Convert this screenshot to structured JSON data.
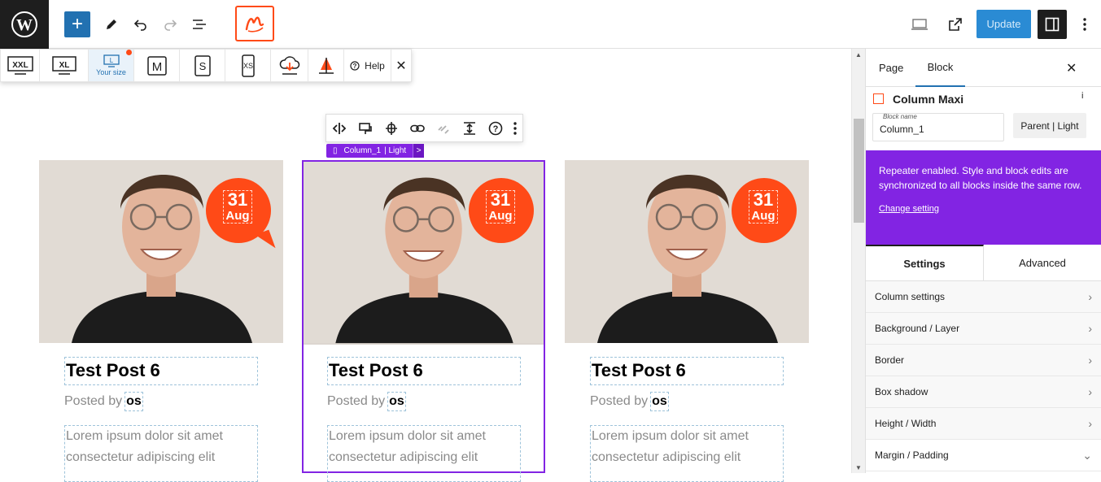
{
  "topbar": {
    "update_label": "Update"
  },
  "responsive": {
    "items": [
      {
        "label": "XXL"
      },
      {
        "label": "XL"
      },
      {
        "label": "L",
        "caption": "Your size"
      },
      {
        "label": "M"
      },
      {
        "label": "S"
      },
      {
        "label": "XS"
      }
    ],
    "help_label": "Help"
  },
  "block_toolbar": {
    "breadcrumb": "Column_1",
    "breadcrumb_style": "| Light",
    "breadcrumb_more": ">"
  },
  "posts": [
    {
      "day": "31",
      "month": "Aug",
      "title": "Test Post 6",
      "posted_by": "Posted by",
      "author": "os",
      "excerpt": "Lorem ipsum dolor sit amet consectetur adipiscing elit"
    },
    {
      "day": "31",
      "month": "Aug",
      "title": "Test Post 6",
      "posted_by": "Posted by",
      "author": "os",
      "excerpt": "Lorem ipsum dolor sit amet consectetur adipiscing elit"
    },
    {
      "day": "31",
      "month": "Aug",
      "title": "Test Post 6",
      "posted_by": "Posted by",
      "author": "os",
      "excerpt": "Lorem ipsum dolor sit amet consectetur adipiscing elit"
    }
  ],
  "panel": {
    "tab_page": "Page",
    "tab_block": "Block",
    "block_title": "Column Maxi",
    "info": "i",
    "block_name_label": "Block name",
    "block_name_value": "Column_1",
    "style_button": "Parent | Light",
    "repeater_text": "Repeater enabled. Style and block edits are synchronized to all blocks inside the same row.",
    "change_setting": "Change setting",
    "settings_tab": "Settings",
    "advanced_tab": "Advanced",
    "accordion": [
      "Column settings",
      "Background / Layer",
      "Border",
      "Box shadow",
      "Height / Width",
      "Margin / Padding"
    ]
  },
  "colors": {
    "accent_purple": "#8224e3",
    "date_orange": "#ff4a17",
    "wp_blue": "#2271b1"
  }
}
